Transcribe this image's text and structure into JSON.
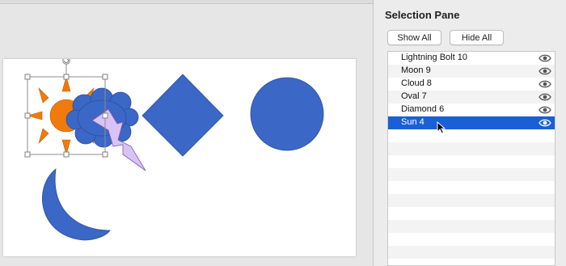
{
  "selection_pane": {
    "title": "Selection Pane",
    "show_all_label": "Show All",
    "hide_all_label": "Hide All",
    "items": [
      {
        "label": "Lightning Bolt 10",
        "icon": "eye-icon",
        "selected": false
      },
      {
        "label": "Moon 9",
        "icon": "eye-icon",
        "selected": false
      },
      {
        "label": "Cloud 8",
        "icon": "eye-icon",
        "selected": false
      },
      {
        "label": "Oval 7",
        "icon": "eye-icon",
        "selected": false
      },
      {
        "label": "Diamond 6",
        "icon": "eye-icon",
        "selected": false
      },
      {
        "label": "Sun 4",
        "icon": "eye-icon",
        "selected": true
      }
    ]
  },
  "colors": {
    "shape_blue": "#3b67c6",
    "sun_orange": "#f17a0d",
    "bolt_lavender": "#d9c3f5",
    "selection_blue": "#1a5fd8"
  }
}
